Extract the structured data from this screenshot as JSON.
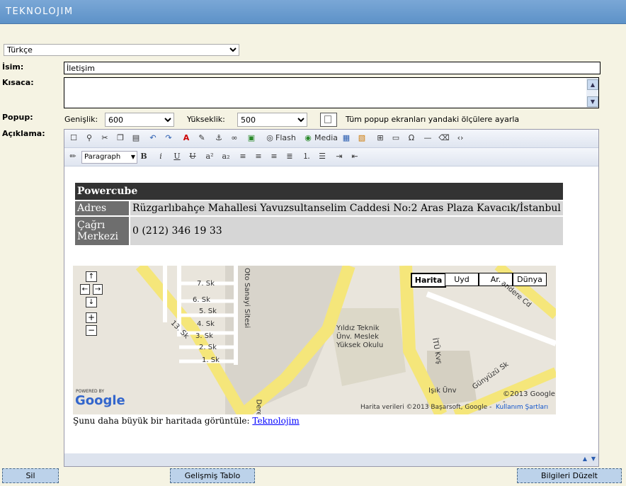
{
  "header": {
    "logo": "TEKNOLOJIM"
  },
  "language": {
    "selected": "Türkçe"
  },
  "labels": {
    "name": "İsim:",
    "short": "Kısaca:",
    "popup": "Popup:",
    "desc": "Açıklama:"
  },
  "name_value": "İletişim",
  "popup": {
    "width_label": "Genişlik:",
    "width_value": "600",
    "height_label": "Yükseklik:",
    "height_value": "500",
    "checkbox_label": "Tüm popup ekranları yandaki ölçülere ayarla"
  },
  "toolbar": {
    "flash": "Flash",
    "media": "Media",
    "format": "Paragraph"
  },
  "content": {
    "title": "Powercube",
    "rows": [
      {
        "label": "Adres",
        "value": "Rüzgarlıbahçe Mahallesi Yavuzsultanselim Caddesi No:2 Aras Plaza Kavacık/İstanbul"
      },
      {
        "label": "Çağrı Merkezi",
        "value": "0 (212) 346 19 33"
      }
    ],
    "map_buttons": [
      "Harita",
      "Uyd",
      "Ar.",
      "Dünya"
    ],
    "map_labels": {
      "copyright": "©2013 Google -",
      "data": "Harita verileri ©2013 Başarsoft, Google -",
      "terms": "Kullanım Şartları",
      "poi": "Yıldız Teknik Ünv. Meslek Yüksek Okulu",
      "poi2": "Işık Ünv",
      "powered": "POWERED BY",
      "google": "Google",
      "street1": "Günyüzü Sk",
      "street2": "İTÜ Kvş",
      "street3": "Oto Sanayi Sitesi",
      "street4": "13. Sk",
      "street5": "Dere",
      "street6": "andere Cd"
    },
    "map_link_text": "Şunu daha büyük bir haritada görüntüle:",
    "map_link": "Teknolojim"
  },
  "buttons": {
    "delete": "Sil",
    "table": "Gelişmiş Tablo",
    "save": "Bilgileri Düzelt"
  },
  "colors": {
    "header": "#6699cc",
    "background": "#f5f3e3",
    "button": "#bcd2ea"
  }
}
